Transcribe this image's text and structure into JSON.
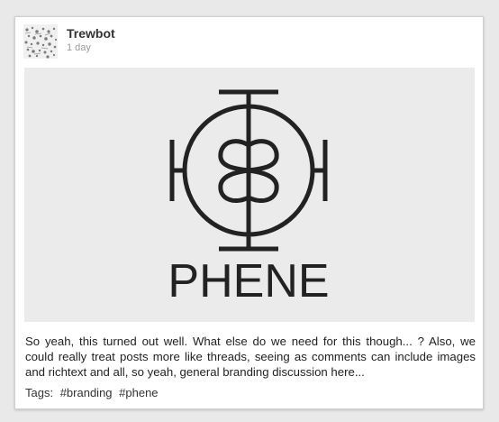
{
  "post": {
    "author": "Trewbot",
    "timestamp": "1 day",
    "image": {
      "logo_text": "PHENE",
      "background": "#ebebeb",
      "ink": "#222222"
    },
    "body": "So yeah, this turned out well. What else do we need for this though... ? Also, we could really treat posts more like threads, seeing as comments can include images and richtext and all, so yeah, general branding discussion here...",
    "tags_label": "Tags:",
    "tags": [
      "#branding",
      "#phene"
    ]
  }
}
